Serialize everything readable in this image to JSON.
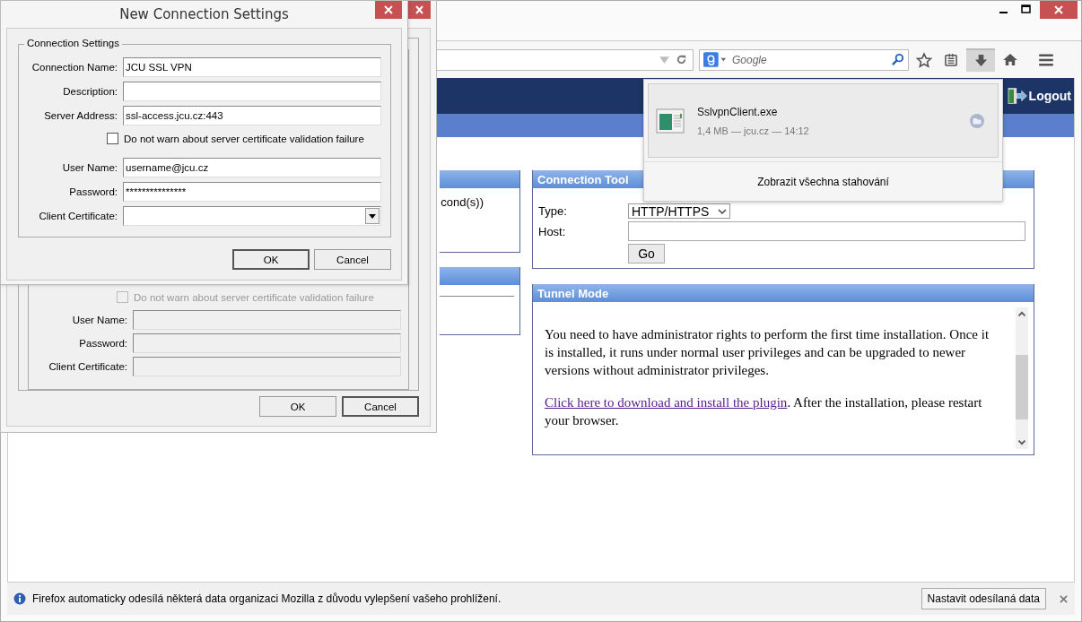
{
  "browser": {
    "search": {
      "placeholder": "Google"
    },
    "download_button": {
      "selected": true
    }
  },
  "page": {
    "header": {
      "logout": "Logout"
    },
    "left_panel": {
      "text": "cond(s))"
    },
    "connection_tool": {
      "title": "Connection Tool",
      "type_label": "Type:",
      "type_value": "HTTP/HTTPS",
      "host_label": "Host:",
      "go_button": "Go"
    },
    "tunnel_mode": {
      "title": "Tunnel Mode",
      "paragraph": "You need to have administrator rights to perform the first time installation. Once it is installed, it runs under normal user privileges and can be upgraded to newer versions without administrator privileges.",
      "link": "Click here to download and install the plugin",
      "link_after": ". After the installation, please restart your browser."
    }
  },
  "download_panel": {
    "file_name": "SslvpnClient.exe",
    "details": "1,4 MB — jcu.cz — 14:12",
    "show_all": "Zobrazit všechna stahování"
  },
  "notification": {
    "message": "Firefox automaticky odesílá některá data organizaci Mozilla z důvodu vylepšení vašeho prohlížení.",
    "button": "Nastavit odesílaná data"
  },
  "back_dialog": {
    "checkbox": {
      "label": "Do not warn about server certificate validation failure",
      "checked": false,
      "disabled": true
    },
    "fields": [
      {
        "label": "User Name:",
        "disabled": true
      },
      {
        "label": "Password:",
        "disabled": true
      },
      {
        "label": "Client Certificate:",
        "disabled": true
      }
    ],
    "buttons": [
      {
        "label": "OK",
        "default": false
      },
      {
        "label": "Cancel",
        "default": true
      }
    ]
  },
  "dialog": {
    "title": "New Connection Settings",
    "group_title": "Connection Settings",
    "fields": [
      {
        "label": "Connection Name:",
        "value": "JCU SSL VPN",
        "kind": "text"
      },
      {
        "label": "Description:",
        "kind": "text"
      },
      {
        "label": "Server Address:",
        "value": "ssl-access.jcu.cz:443",
        "kind": "text"
      },
      {
        "kind": "checkbox",
        "label": "Do not warn about server certificate validation failure",
        "checked": false
      },
      {
        "label": "User Name:",
        "value": "username@jcu.cz",
        "kind": "text"
      },
      {
        "label": "Password:",
        "value": "***************",
        "kind": "text"
      },
      {
        "label": "Client Certificate:",
        "kind": "dropdown"
      }
    ],
    "buttons": [
      {
        "label": "OK",
        "default": true
      },
      {
        "label": "Cancel",
        "default": false
      }
    ]
  }
}
